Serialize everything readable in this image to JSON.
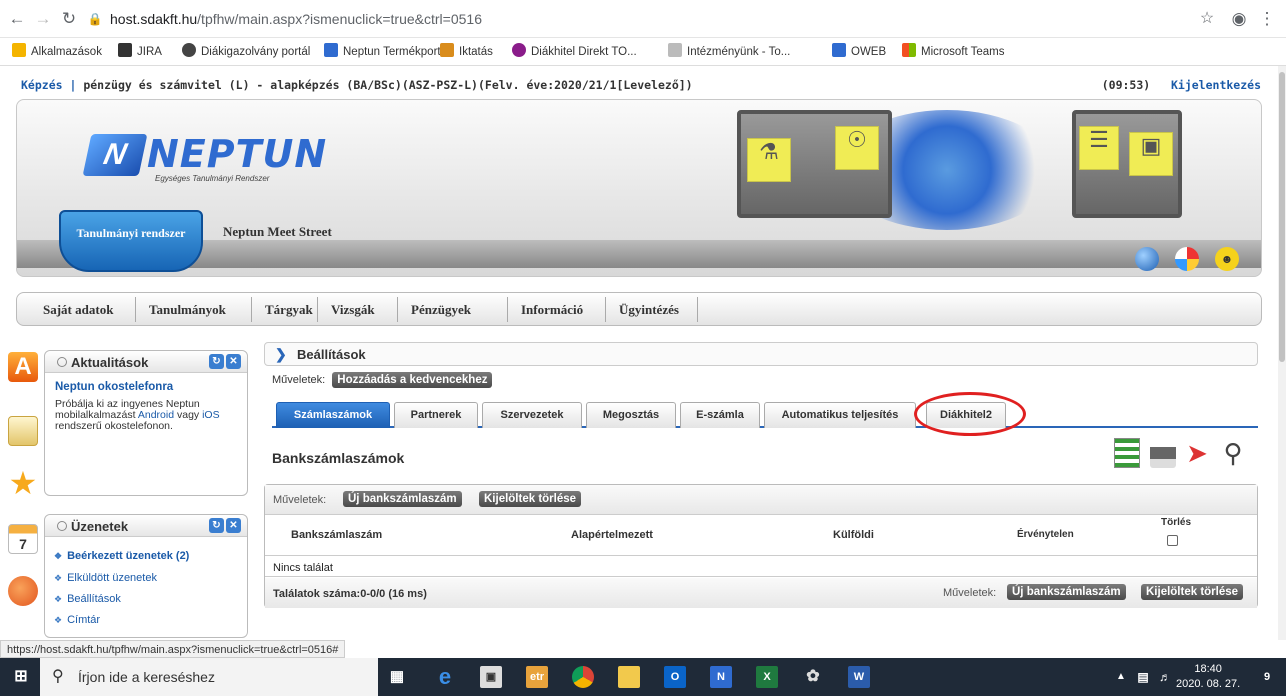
{
  "browser": {
    "url_host": "host.sdakft.hu",
    "url_path": "/tpfhw/main.aspx?ismenuclick=true&ctrl=0516",
    "bookmarks": [
      "Alkalmazások",
      "JIRA",
      "Diákigazolvány portál",
      "Neptun Termékportál",
      "Iktatás",
      "Diákhitel Direkt TO...",
      "Intézményünk - To...",
      "OWEB",
      "Microsoft Teams"
    ]
  },
  "top": {
    "prefix": "Képzés |",
    "training": "pénzügy és számvitel (L) - alapképzés (BA/BSc)(ASZ-PSZ-L)(Felv. éve:2020/21/1[Levelező])",
    "time": "(09:53)",
    "logout": "Kijelentkezés"
  },
  "banner": {
    "logo_mark": "N",
    "logo_name": "NEPTUN",
    "logo_sub": "Egységes Tanulmányi Rendszer",
    "tab_active": "Tanulmányi rendszer",
    "tab_other": "Neptun Meet Street"
  },
  "menu": [
    "Saját adatok",
    "Tanulmányok",
    "Tárgyak",
    "Vizsgák",
    "Pénzügyek",
    "Információ",
    "Ügyintézés"
  ],
  "news": {
    "title": "Aktualitások",
    "item_title": "Neptun okostelefonra",
    "body1": "Próbálja ki az ingyenes Neptun mobilalkalmazást ",
    "android": "Android",
    "body2": " vagy ",
    "ios": "iOS",
    "body3": " rendszerű okostelefonon."
  },
  "messages": {
    "title": "Üzenetek",
    "items": [
      "Beérkezett üzenetek (2)",
      "Elküldött üzenetek",
      "Beállítások",
      "Címtár"
    ]
  },
  "content": {
    "breadcrumb": "Beállítások",
    "ops_label": "Műveletek:",
    "fav_button": "Hozzáadás a kedvencekhez",
    "tabs": [
      "Számlaszámok",
      "Partnerek",
      "Szervezetek",
      "Megosztás",
      "E-számla",
      "Automatikus teljesítés",
      "Diákhitel2"
    ],
    "section_title": "Bankszámlaszámok",
    "new_button": "Új bankszámlaszám",
    "delete_button": "Kijelöltek törlése",
    "headers": [
      "Bankszámlaszám",
      "Alapértelmezett",
      "Külföldi",
      "Érvénytelen",
      "Törlés"
    ],
    "no_result": "Nincs találat",
    "result_count": "Találatok száma:0-0/0 (16 ms)"
  },
  "status_url": "https://host.sdakft.hu/tpfhw/main.aspx?ismenuclick=true&ctrl=0516#",
  "taskbar": {
    "search_placeholder": "Írjon ide a kereséshez",
    "time": "18:40",
    "date": "2020. 08. 27.",
    "notif": "9"
  },
  "colors": {
    "accent": "#2a66b8",
    "highlight": "#e02020"
  }
}
